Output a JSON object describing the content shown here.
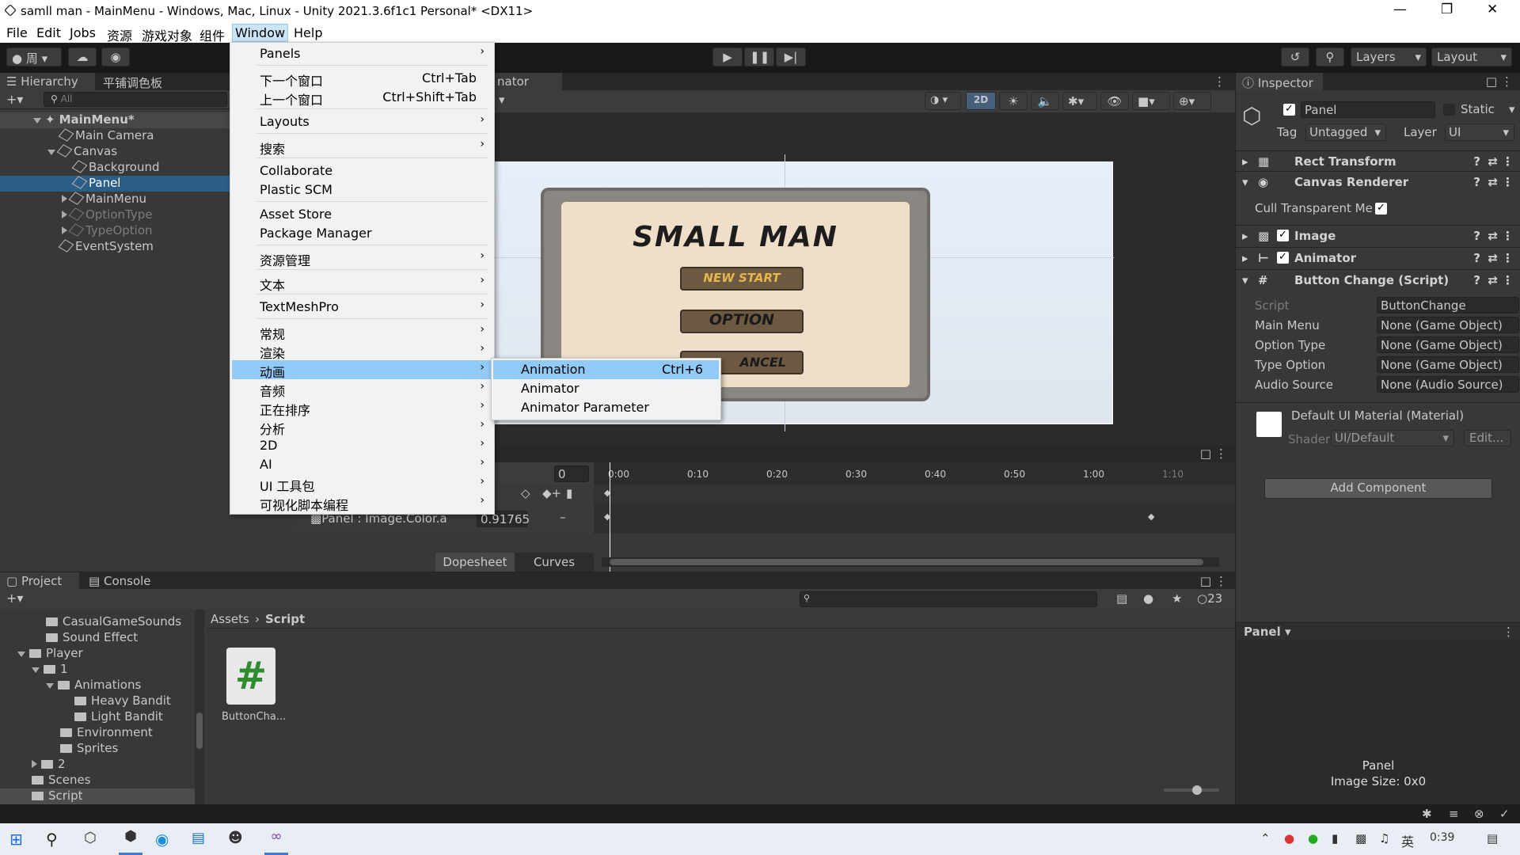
{
  "window": {
    "title": "samll man - MainMenu - Windows, Mac, Linux - Unity 2021.3.6f1c1 Personal* <DX11>"
  },
  "menubar": [
    "File",
    "Edit",
    "Jobs",
    "资源",
    "游戏对象",
    "组件",
    "Window",
    "Help"
  ],
  "toolbar": {
    "account": "周",
    "layers": "Layers",
    "layout": "Layout"
  },
  "hierarchy": {
    "tabs": [
      "Hierarchy",
      "平铺调色板"
    ],
    "search_placeholder": "All",
    "items": [
      {
        "label": "MainMenu*",
        "depth": 0
      },
      {
        "label": "Main Camera",
        "depth": 1
      },
      {
        "label": "Canvas",
        "depth": 1
      },
      {
        "label": "Background",
        "depth": 2
      },
      {
        "label": "Panel",
        "depth": 2
      },
      {
        "label": "MainMenu",
        "depth": 2
      },
      {
        "label": "OptionType",
        "depth": 2
      },
      {
        "label": "TypeOption",
        "depth": 2
      },
      {
        "label": "EventSystem",
        "depth": 1
      }
    ]
  },
  "window_menu": {
    "items": [
      {
        "label": "Panels",
        "shortcut": "",
        "submenu": true
      },
      {
        "label": "下一个窗口",
        "shortcut": "Ctrl+Tab",
        "submenu": false
      },
      {
        "label": "上一个窗口",
        "shortcut": "Ctrl+Shift+Tab",
        "submenu": false
      },
      {
        "label": "Layouts",
        "shortcut": "",
        "submenu": true
      },
      {
        "label": "搜索",
        "shortcut": "",
        "submenu": true
      },
      {
        "label": "Collaborate",
        "shortcut": "",
        "submenu": false
      },
      {
        "label": "Plastic SCM",
        "shortcut": "",
        "submenu": false
      },
      {
        "label": "Asset Store",
        "shortcut": "",
        "submenu": false
      },
      {
        "label": "Package Manager",
        "shortcut": "",
        "submenu": false
      },
      {
        "label": "资源管理",
        "shortcut": "",
        "submenu": true
      },
      {
        "label": "文本",
        "shortcut": "",
        "submenu": true
      },
      {
        "label": "TextMeshPro",
        "shortcut": "",
        "submenu": true
      },
      {
        "label": "常规",
        "shortcut": "",
        "submenu": true
      },
      {
        "label": "渲染",
        "shortcut": "",
        "submenu": true
      },
      {
        "label": "动画",
        "shortcut": "",
        "submenu": true
      },
      {
        "label": "音频",
        "shortcut": "",
        "submenu": true
      },
      {
        "label": "正在排序",
        "shortcut": "",
        "submenu": true
      },
      {
        "label": "分析",
        "shortcut": "",
        "submenu": true
      },
      {
        "label": "2D",
        "shortcut": "",
        "submenu": true
      },
      {
        "label": "AI",
        "shortcut": "",
        "submenu": true
      },
      {
        "label": "UI 工具包",
        "shortcut": "",
        "submenu": true
      },
      {
        "label": "可视化脚本编程",
        "shortcut": "",
        "submenu": true
      }
    ]
  },
  "anim_submenu": [
    {
      "label": "Animation",
      "shortcut": "Ctrl+6"
    },
    {
      "label": "Animator",
      "shortcut": ""
    },
    {
      "label": "Animator Parameter",
      "shortcut": ""
    }
  ],
  "scene": {
    "tab_fragment": "nator",
    "mode_2d": "2D",
    "game_title": "SMALL   MAN",
    "buttons": [
      "NEW START",
      "OPTION",
      "CANCEL"
    ],
    "btn_visible": [
      "NEW START",
      "OPTION",
      "ANCEL"
    ]
  },
  "animation": {
    "frame": "0",
    "ticks": [
      "0:00",
      "0:10",
      "0:20",
      "0:30",
      "0:40",
      "0:50",
      "1:00",
      "1:10"
    ],
    "property": "Panel : Image.Color.a",
    "value": "0.91765",
    "tabs": [
      "Dopesheet",
      "Curves"
    ]
  },
  "inspector": {
    "tab": "Inspector",
    "name": "Panel",
    "static": "Static",
    "tag_label": "Tag",
    "tag": "Untagged",
    "layer_label": "Layer",
    "layer": "UI",
    "components": [
      "Rect Transform",
      "Canvas Renderer",
      "Image",
      "Animator",
      "Button Change (Script)"
    ],
    "cull_label": "Cull Transparent Me",
    "fields": [
      {
        "label": "Script",
        "value": "ButtonChange"
      },
      {
        "label": "Main Menu",
        "value": "None (Game Object)"
      },
      {
        "label": "Option Type",
        "value": "None (Game Object)"
      },
      {
        "label": "Type Option",
        "value": "None (Game Object)"
      },
      {
        "label": "Audio Source",
        "value": "None (Audio Source)"
      }
    ],
    "material": "Default UI Material (Material)",
    "shader_label": "Shader",
    "shader": "UI/Default",
    "edit": "Edit...",
    "add_component": "Add Component",
    "preview_name": "Panel",
    "preview_label": "Panel",
    "preview_size": "Image Size: 0x0"
  },
  "project": {
    "tabs": [
      "Project",
      "Console"
    ],
    "tree": [
      {
        "label": "CasualGameSounds",
        "depth": 2,
        "arrow": ""
      },
      {
        "label": "Sound Effect",
        "depth": 2,
        "arrow": ""
      },
      {
        "label": "Player",
        "depth": 1,
        "arrow": "open"
      },
      {
        "label": "1",
        "depth": 2,
        "arrow": "open"
      },
      {
        "label": "Animations",
        "depth": 3,
        "arrow": "open"
      },
      {
        "label": "Heavy Bandit",
        "depth": 4,
        "arrow": ""
      },
      {
        "label": "Light Bandit",
        "depth": 4,
        "arrow": ""
      },
      {
        "label": "Environment",
        "depth": 3,
        "arrow": ""
      },
      {
        "label": "Sprites",
        "depth": 3,
        "arrow": ""
      },
      {
        "label": "2",
        "depth": 2,
        "arrow": "closed"
      },
      {
        "label": "Scenes",
        "depth": 1,
        "arrow": ""
      },
      {
        "label": "Script",
        "depth": 1,
        "arrow": ""
      }
    ],
    "breadcrumb": [
      "Assets",
      "Script"
    ],
    "asset": "ButtonCha...",
    "hidden_count": "23"
  },
  "taskbar": {
    "ime": "英",
    "time": "0:39"
  }
}
